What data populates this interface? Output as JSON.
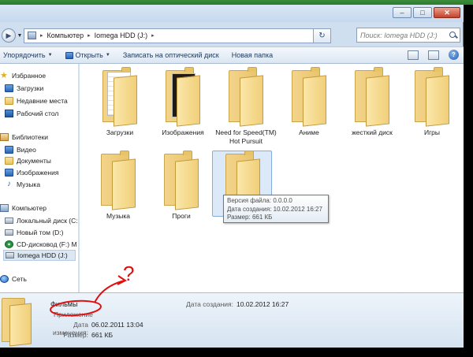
{
  "window": {
    "controls": {
      "minimize": "–",
      "maximize": "□",
      "close": "✕"
    }
  },
  "address": {
    "crumbs": [
      "Компьютер",
      "Iomega HDD (J:)"
    ],
    "search_placeholder": "Поиск: Iomega HDD (J:)"
  },
  "toolbar": {
    "organize": "Упорядочить",
    "open": "Открыть",
    "burn": "Записать на оптический диск",
    "new_folder": "Новая папка",
    "help": "?"
  },
  "nav": {
    "favorites": "Избранное",
    "downloads": "Загрузки",
    "recent": "Недавние места",
    "desktop": "Рабочий стол",
    "libraries": "Библиотеки",
    "video": "Видео",
    "documents": "Документы",
    "images": "Изображения",
    "music": "Музыка",
    "computer": "Компьютер",
    "local_c": "Локальный диск (C:",
    "new_d": "Новый том (D:)",
    "cd_f": "CD-дисковод (F:) M",
    "iomega": "Iomega HDD (J:)",
    "network": "Сеть"
  },
  "folders": [
    {
      "label": "Загрузки"
    },
    {
      "label": "Изображения"
    },
    {
      "label": "Need for Speed(TM) Hot Pursuit"
    },
    {
      "label": "Аниме"
    },
    {
      "label": "жесткий диск"
    },
    {
      "label": "Игры"
    },
    {
      "label": "Музыка"
    },
    {
      "label": "Проги"
    },
    {
      "label": ""
    }
  ],
  "tooltip": {
    "line1": "Версия файла: 0.0.0.0",
    "line2": "Дата создания: 10.02.2012 16:27",
    "line3": "Размер: 661 КБ"
  },
  "details": {
    "name": "Фильмы",
    "type": "Приложение",
    "modified_label": "Дата изменения:",
    "modified_value": "06.02.2011 13:04",
    "size_label": "Размер:",
    "size_value": "661 КБ",
    "created_label": "Дата создания:",
    "created_value": "10.02.2012 16:27"
  },
  "annotation": {
    "mark": "?",
    "color": "#e01010"
  }
}
